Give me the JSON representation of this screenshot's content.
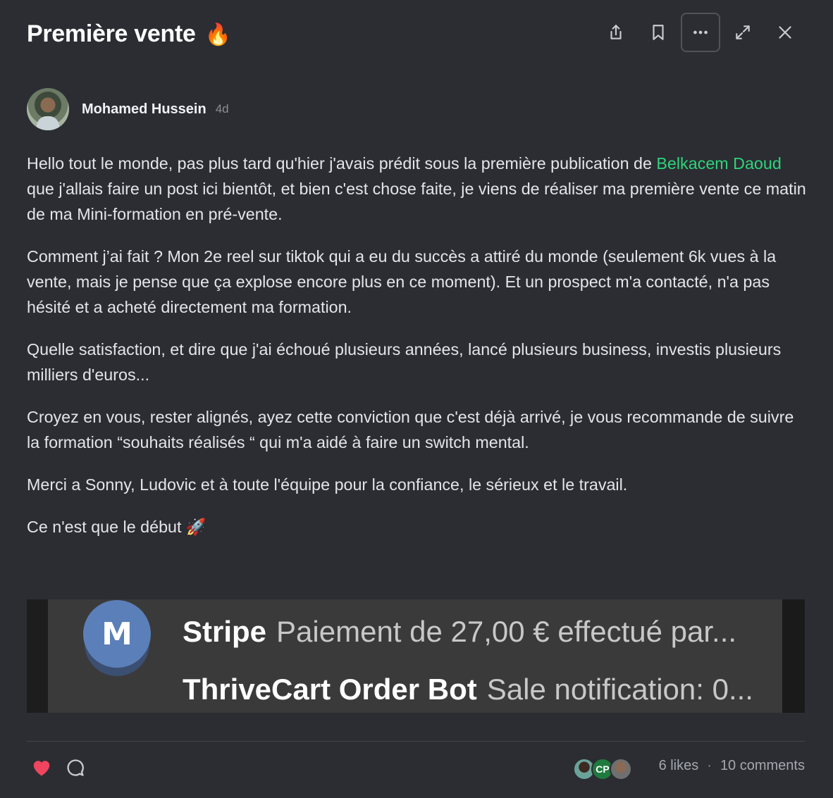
{
  "post": {
    "title": "Première vente",
    "title_emoji": "🔥",
    "author": "Mohamed Hussein",
    "time": "4d"
  },
  "toolbar": {
    "icons": [
      "share-icon",
      "bookmark-icon",
      "more-icon",
      "expand-icon",
      "close-icon"
    ]
  },
  "body": {
    "p1_before": "Hello tout le monde, pas plus tard qu'hier j'avais prédit sous la première publication de ",
    "p1_mention": "Belkacem Daoud",
    "p1_after": " que j'allais faire un post ici bientôt, et bien c'est chose faite, je viens de réaliser ma première vente ce matin de ma Mini-formation en pré-vente.",
    "p2": "Comment j’ai fait ? Mon 2e reel sur tiktok qui a eu du succès a attiré du monde (seulement 6k vues à la vente, mais je pense que ça explose encore plus en ce moment). Et un prospect m'a contacté, n'a pas hésité et a acheté directement ma formation.",
    "p3": "Quelle satisfaction, et dire que j'ai échoué plusieurs années, lancé plusieurs business, investis plusieurs milliers d'euros...",
    "p4": "Croyez en vous, rester alignés, ayez cette conviction que c'est déjà arrivé, je vous recommande de suivre la formation “souhaits réalisés “ qui m'a aidé à faire un switch mental.",
    "p5": "Merci a Sonny, Ludovic et à toute l'équipe pour la confiance, le sérieux et le travail.",
    "p6": "Ce n'est que le début 🚀"
  },
  "media": {
    "logo_letter": "M",
    "line1_sender": "Stripe",
    "line1_text": "Paiement de 27,00 € effectué par...",
    "line2_sender": "ThriveCart Order Bot",
    "line2_text": "Sale notification: 0..."
  },
  "footer": {
    "liker_initials": "CP",
    "likes": "6 likes",
    "separator": "·",
    "comments": "10 comments"
  },
  "colors": {
    "background": "#2b2d33",
    "mention": "#2ed47a",
    "heart": "#f0455f"
  }
}
